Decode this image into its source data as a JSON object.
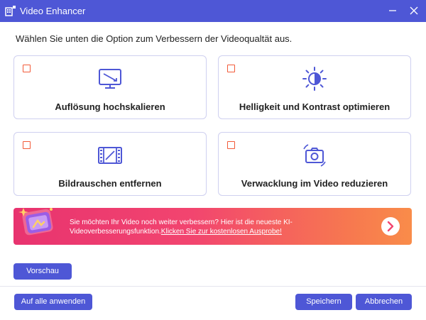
{
  "window": {
    "title": "Video Enhancer",
    "titlebar_color": "#4e57d6"
  },
  "instruction": "Wählen Sie unten die Option zum Verbessern der Videoqualtät aus.",
  "options": [
    {
      "label": "Auflösung hochskalieren",
      "checked": false,
      "icon": "monitor-icon"
    },
    {
      "label": "Helligkeit und Kontrast optimieren",
      "checked": false,
      "icon": "brightness-icon"
    },
    {
      "label": "Bildrauschen entfernen",
      "checked": false,
      "icon": "film-icon"
    },
    {
      "label": "Verwacklung im Video reduzieren",
      "checked": false,
      "icon": "camera-stabilize-icon"
    }
  ],
  "banner": {
    "text": "Sie möchten Ihr Video noch weiter verbessern? Hier ist die neueste KI-Videoverbesserungsfunktion.",
    "link": "Klicken Sie zur kostenlosen Ausprobe!"
  },
  "buttons": {
    "preview": "Vorschau",
    "apply_all": "Auf alle anwenden",
    "save": "Speichern",
    "cancel": "Abbrechen"
  },
  "colors": {
    "accent": "#4e57d6",
    "checkbox": "#f25a38",
    "banner_start": "#e8336f",
    "banner_end": "#f98c4a"
  }
}
